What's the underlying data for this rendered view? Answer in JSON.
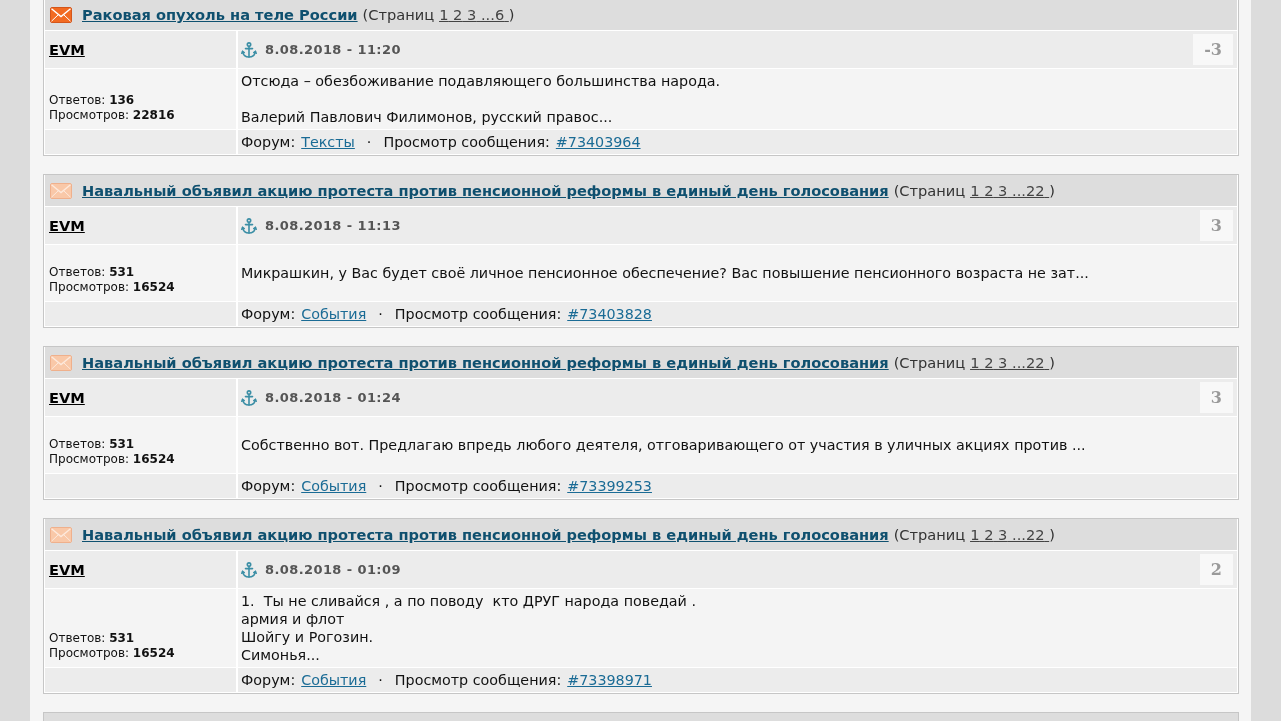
{
  "posts": [
    {
      "unread": true,
      "title": "Раковая опухоль на теле России",
      "pages_label": "(Страниц",
      "pages": [
        "1",
        "2",
        "3",
        "...6"
      ],
      "pages_close": ")",
      "author": "EVM",
      "date": "8.08.2018 - 11:20",
      "score": "-3",
      "stats": [
        "Ответов: **136**",
        "Просмотров: **22816**"
      ],
      "body": "Отсюда – обезбоживание подавляющего большинства народа.\n\nВалерий Павлович Филимонов, русский правос...",
      "forum_label": "Форум:",
      "forum": "Тексты",
      "separator": "·",
      "message_label": "Просмотр сообщения:",
      "message_id": "#73403964"
    },
    {
      "unread": false,
      "title": "Навальный объявил акцию протеста против пенсионной реформы в единый день голосования",
      "pages_label": "(Страниц",
      "pages": [
        "1",
        "2",
        "3",
        "...22"
      ],
      "pages_close": ")",
      "author": "EVM",
      "date": "8.08.2018 - 11:13",
      "score": "3",
      "stats": [
        "Ответов: **531**",
        "Просмотров: **16524**"
      ],
      "body": "Микрашкин, у Вас будет своё личное пенсионное обеспечение? Вас повышение пенсионного возраста не зат...",
      "forum_label": "Форум:",
      "forum": "События",
      "separator": "·",
      "message_label": "Просмотр сообщения:",
      "message_id": "#73403828"
    },
    {
      "unread": false,
      "title": "Навальный объявил акцию протеста против пенсионной реформы в единый день голосования",
      "pages_label": "(Страниц",
      "pages": [
        "1",
        "2",
        "3",
        "...22"
      ],
      "pages_close": ")",
      "author": "EVM",
      "date": "8.08.2018 - 01:24",
      "score": "3",
      "stats": [
        "Ответов: **531**",
        "Просмотров: **16524**"
      ],
      "body": "Собственно вот. Предлагаю впредь любого деятеля, отговаривающего от участия в уличных акциях против ...",
      "forum_label": "Форум:",
      "forum": "События",
      "separator": "·",
      "message_label": "Просмотр сообщения:",
      "message_id": "#73399253"
    },
    {
      "unread": false,
      "title": "Навальный объявил акцию протеста против пенсионной реформы в единый день голосования",
      "pages_label": "(Страниц",
      "pages": [
        "1",
        "2",
        "3",
        "...22"
      ],
      "pages_close": ")",
      "author": "EVM",
      "date": "8.08.2018 - 01:09",
      "score": "2",
      "stats": [
        "Ответов: **531**",
        "Просмотров: **16524**"
      ],
      "body": "1.  Ты не сливайся , а по поводу  кто ДРУГ народа поведай .\nармия и флот\nШойгу и Рогозин.\nСимонья...",
      "forum_label": "Форум:",
      "forum": "События",
      "separator": "·",
      "message_label": "Просмотр сообщения:",
      "message_id": "#73398971"
    }
  ]
}
